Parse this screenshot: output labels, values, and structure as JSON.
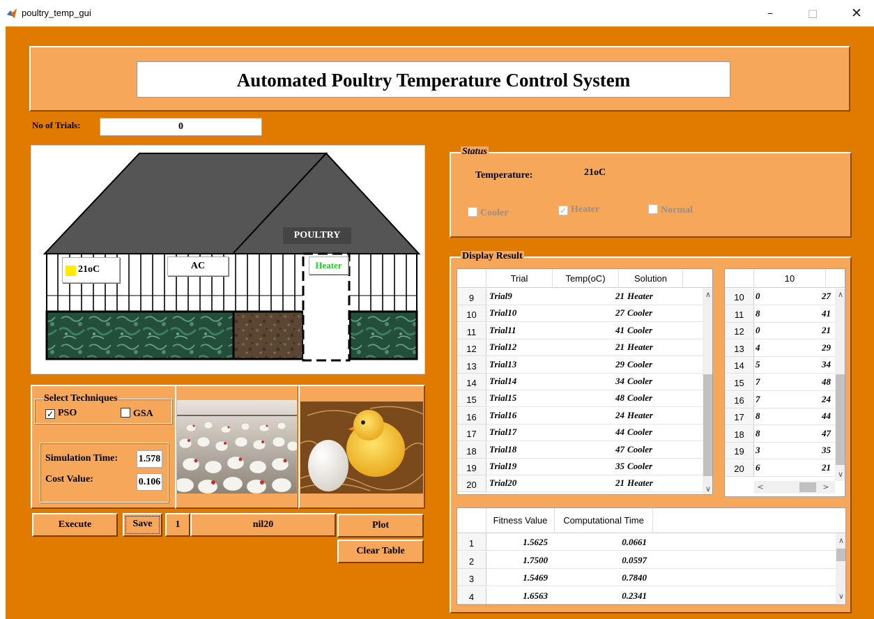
{
  "window": {
    "title": "poultry_temp_gui",
    "minimize": "–",
    "maximize": "□",
    "close": "✕"
  },
  "header": {
    "title": "Automated Poultry Temperature Control System"
  },
  "trials": {
    "label": "No of Trials:",
    "value": "0"
  },
  "house": {
    "poultry_label": "POULTRY",
    "temp_display": "21oC",
    "ac_label": "AC",
    "heater_label": "Heater",
    "colors": {
      "roof": "#555555",
      "indicator": "#FFEA00",
      "heater_text": "#19D219"
    }
  },
  "techniques": {
    "title": "Select Techniques",
    "pso": {
      "label": "PSO",
      "checked": true
    },
    "gsa": {
      "label": "GSA",
      "checked": false
    },
    "sim_time_label": "Simulation Time:",
    "sim_time_value": "1.578",
    "cost_label": "Cost Value:",
    "cost_value": "0.106"
  },
  "controls": {
    "execute": "Execute",
    "save": "Save",
    "index_value": "1",
    "name_value": "nil20",
    "plot": "Plot",
    "clear_table": "Clear Table"
  },
  "status": {
    "title": "Status",
    "temp_label": "Temperature:",
    "temp_value": "21oC",
    "cooler": {
      "label": "Cooler",
      "checked": false
    },
    "heater": {
      "label": "Heater",
      "checked": true
    },
    "normal": {
      "label": "Normal",
      "checked": false
    }
  },
  "display_result": {
    "title": "Display Result",
    "columns": [
      "Trial",
      "Temp(oC)",
      "Solution"
    ],
    "rows": [
      {
        "idx": "9",
        "trial": "Trial9",
        "temp": "21",
        "solution": "Heater"
      },
      {
        "idx": "10",
        "trial": "Trial10",
        "temp": "27",
        "solution": "Cooler"
      },
      {
        "idx": "11",
        "trial": "Trial11",
        "temp": "41",
        "solution": "Cooler"
      },
      {
        "idx": "12",
        "trial": "Trial12",
        "temp": "21",
        "solution": "Heater"
      },
      {
        "idx": "13",
        "trial": "Trial13",
        "temp": "29",
        "solution": "Cooler"
      },
      {
        "idx": "14",
        "trial": "Trial14",
        "temp": "34",
        "solution": "Cooler"
      },
      {
        "idx": "15",
        "trial": "Trial15",
        "temp": "48",
        "solution": "Cooler"
      },
      {
        "idx": "16",
        "trial": "Trial16",
        "temp": "24",
        "solution": "Heater"
      },
      {
        "idx": "17",
        "trial": "Trial17",
        "temp": "44",
        "solution": "Cooler"
      },
      {
        "idx": "18",
        "trial": "Trial18",
        "temp": "47",
        "solution": "Cooler"
      },
      {
        "idx": "19",
        "trial": "Trial19",
        "temp": "35",
        "solution": "Cooler"
      },
      {
        "idx": "20",
        "trial": "Trial20",
        "temp": "21",
        "solution": "Heater"
      }
    ]
  },
  "side_table": {
    "column": "10",
    "rows": [
      {
        "idx": "10",
        "a": "0",
        "b": "27"
      },
      {
        "idx": "11",
        "a": "8",
        "b": "41"
      },
      {
        "idx": "12",
        "a": "0",
        "b": "21"
      },
      {
        "idx": "13",
        "a": "4",
        "b": "29"
      },
      {
        "idx": "14",
        "a": "5",
        "b": "34"
      },
      {
        "idx": "15",
        "a": "7",
        "b": "48"
      },
      {
        "idx": "16",
        "a": "7",
        "b": "24"
      },
      {
        "idx": "17",
        "a": "8",
        "b": "44"
      },
      {
        "idx": "18",
        "a": "8",
        "b": "47"
      },
      {
        "idx": "19",
        "a": "3",
        "b": "35"
      },
      {
        "idx": "20",
        "a": "6",
        "b": "21"
      }
    ]
  },
  "fitness_table": {
    "columns": [
      "Fitness Value",
      "Computational Time"
    ],
    "rows": [
      {
        "idx": "1",
        "fitness": "1.5625",
        "time": "0.0661"
      },
      {
        "idx": "2",
        "fitness": "1.7500",
        "time": "0.0597"
      },
      {
        "idx": "3",
        "fitness": "1.5469",
        "time": "0.7840"
      },
      {
        "idx": "4",
        "fitness": "1.6563",
        "time": "0.2341"
      }
    ]
  },
  "icons": {
    "app": "matlab-icon",
    "scroll_up": "▲",
    "scroll_down": "▼",
    "scroll_left": "<",
    "scroll_right": ">",
    "check": "✓"
  },
  "theme": {
    "background": "#E07B00",
    "panel": "#F7A75A"
  }
}
